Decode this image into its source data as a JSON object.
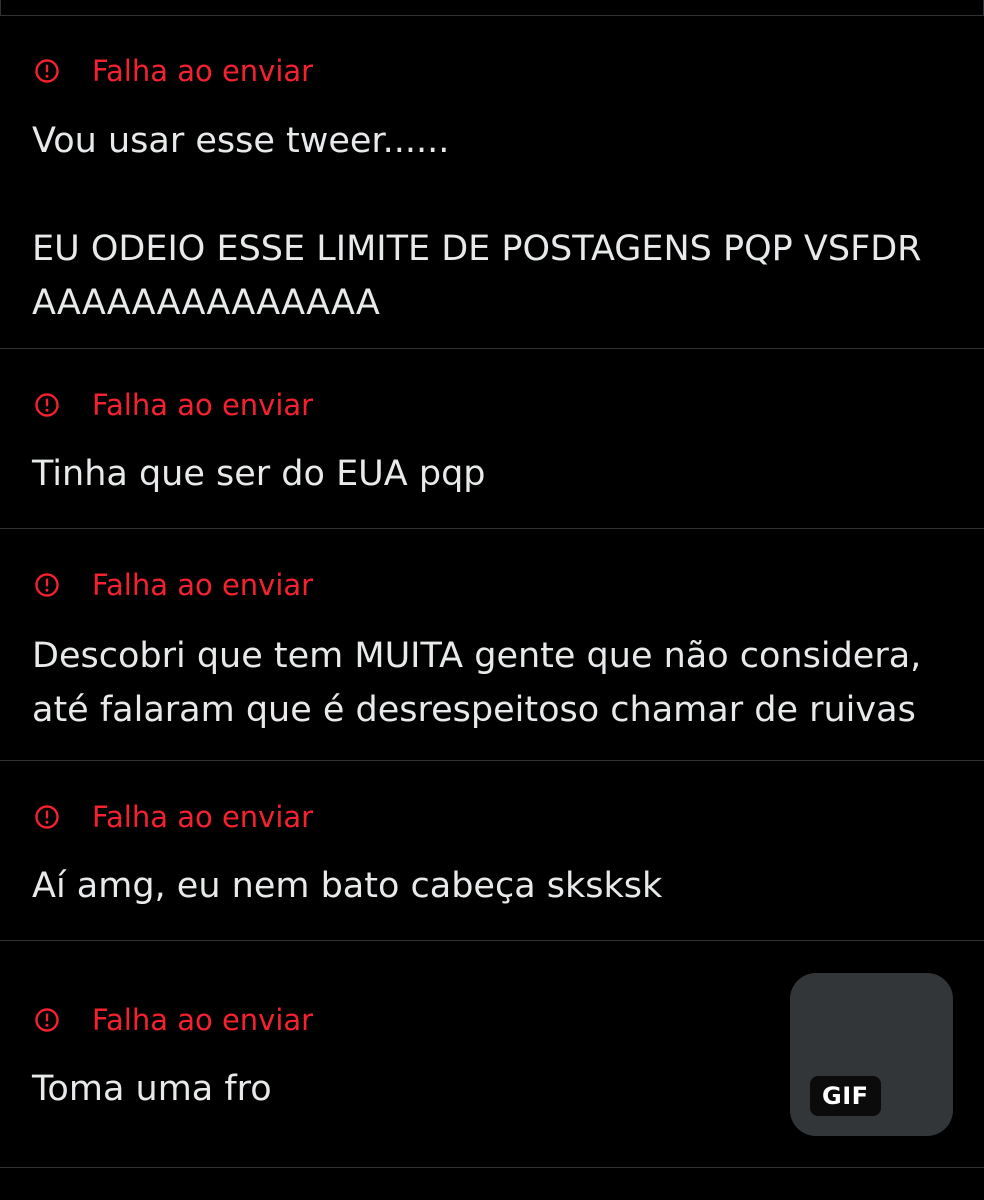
{
  "colors": {
    "background": "#000000",
    "divider": "#2f3336",
    "error": "#f4212e",
    "text": "#e7e9ea",
    "gif_card": "#333639"
  },
  "messages": [
    {
      "status_icon": "alert-circle-icon",
      "status": "Falha ao enviar",
      "text": "Vou usar esse tweer......\n\nEU ODEIO ESSE LIMITE DE POSTAGENS PQP VSFDR AAAAAAAAAAAAAA"
    },
    {
      "status_icon": "alert-circle-icon",
      "status": "Falha ao enviar",
      "text": "Tinha que ser do EUA pqp"
    },
    {
      "status_icon": "alert-circle-icon",
      "status": "Falha ao enviar",
      "text": "Descobri que tem MUITA gente que não considera, até falaram que é desrespeitoso chamar de ruivas"
    },
    {
      "status_icon": "alert-circle-icon",
      "status": "Falha ao enviar",
      "text": "Aí amg, eu nem bato cabeça sksksk"
    },
    {
      "status_icon": "alert-circle-icon",
      "status": "Falha ao enviar",
      "text": "Toma uma fro",
      "attachment": {
        "badge": "GIF"
      }
    }
  ]
}
